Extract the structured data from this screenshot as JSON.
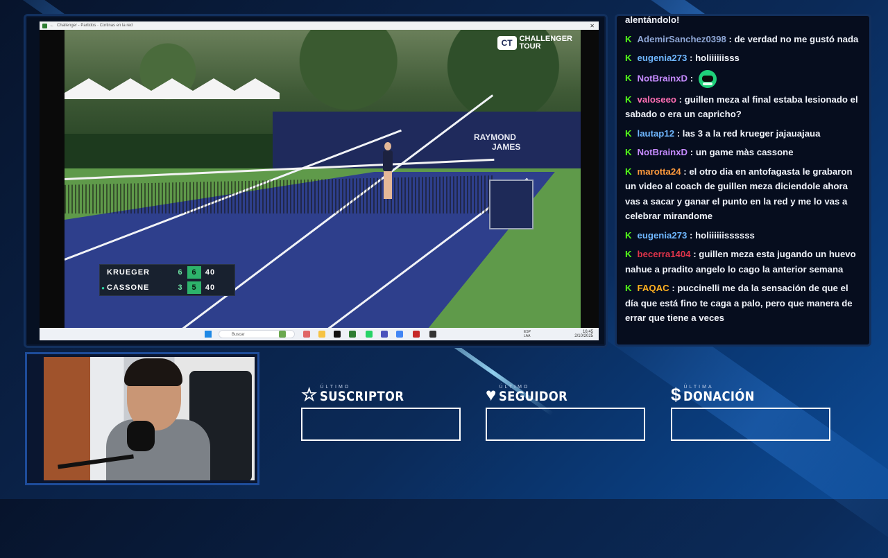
{
  "browser": {
    "title": "Challenger - Partidos · Cortinas en la red"
  },
  "broadcast": {
    "brand_line1": "CHALLENGER",
    "brand_line2": "TOUR",
    "wall_text_1": "RAYMOND",
    "wall_text_2": "JAMES"
  },
  "scoreboard": {
    "players": [
      {
        "name": "KRUEGER",
        "set": "6",
        "game": "6",
        "points": "40",
        "serving": false
      },
      {
        "name": "CASSONE",
        "set": "3",
        "game": "5",
        "points": "40",
        "serving": true
      }
    ]
  },
  "taskbar": {
    "search_placeholder": "Buscar",
    "lang_line1": "ESP",
    "lang_line2": "LAA",
    "time": "16:45",
    "date": "2/10/2025"
  },
  "chat": {
    "messages": [
      {
        "user": "",
        "color": "#f0f3fa",
        "text": "alentándolo!"
      },
      {
        "user": "AdemirSanchez0398",
        "color": "#8fa7d6",
        "text": "de verdad no me gustó nada"
      },
      {
        "user": "eugenia273",
        "color": "#6fb7ff",
        "text": "holiiiiiisss"
      },
      {
        "user": "NotBrainxD",
        "color": "#c68bff",
        "text": "",
        "emote": "green-emote"
      },
      {
        "user": "valoseeo",
        "color": "#ff6fb4",
        "text": "guillen meza al final estaba lesionado el sabado o era un capricho?"
      },
      {
        "user": "lautap12",
        "color": "#6fb7ff",
        "text": "las 3 a la red krueger jajauajaua"
      },
      {
        "user": "NotBrainxD",
        "color": "#c68bff",
        "text": "un game màs cassone"
      },
      {
        "user": "marotta24",
        "color": "#ff9a3c",
        "text": "el otro dia en antofagasta le grabaron un video al coach de guillen meza diciendole ahora vas a sacar y ganar el punto en la red y me lo vas a celebrar mirandome"
      },
      {
        "user": "eugenia273",
        "color": "#6fb7ff",
        "text": "holiiiiiissssss"
      },
      {
        "user": "becerra1404",
        "color": "#e0344a",
        "text": "guillen meza esta jugando un huevo nahue a pradito angelo lo cago la anterior semana"
      },
      {
        "user": "FAQAC",
        "color": "#ffb020",
        "text": "puccinelli me da la sensación de que el día que está fino te caga a palo, pero que manera de errar que tiene a veces"
      }
    ]
  },
  "goals": [
    {
      "icon": "☆",
      "small": "ÚLTIMO",
      "title": "SUSCRIPTOR"
    },
    {
      "icon": "♥",
      "small": "ÚLTIMO",
      "title": "SEGUIDOR"
    },
    {
      "icon": "$",
      "small": "ÚLTIMA",
      "title": "DONACIÓN"
    }
  ]
}
